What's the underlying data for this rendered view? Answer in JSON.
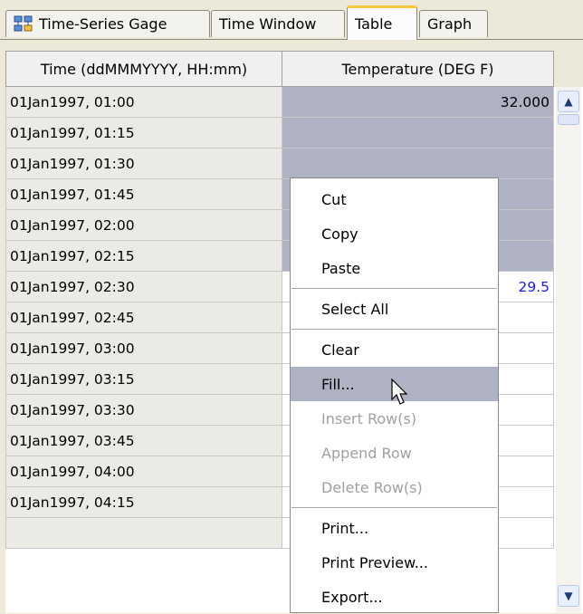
{
  "tabs": [
    {
      "label": "Time-Series Gage",
      "icon": "gage-icon"
    },
    {
      "label": "Time Window"
    },
    {
      "label": "Table",
      "active": true
    },
    {
      "label": "Graph"
    }
  ],
  "table": {
    "columns": [
      "Time (ddMMMYYYY, HH:mm)",
      "Temperature (DEG F)"
    ],
    "rows": [
      {
        "time": "01Jan1997, 01:00",
        "value": "32.000"
      },
      {
        "time": "01Jan1997, 01:15",
        "value": ""
      },
      {
        "time": "01Jan1997, 01:30",
        "value": ""
      },
      {
        "time": "01Jan1997, 01:45",
        "value": ""
      },
      {
        "time": "01Jan1997, 02:00",
        "value": ""
      },
      {
        "time": "01Jan1997, 02:15",
        "value": ""
      },
      {
        "time": "01Jan1997, 02:30",
        "value": "29.5"
      },
      {
        "time": "01Jan1997, 02:45",
        "value": ""
      },
      {
        "time": "01Jan1997, 03:00",
        "value": ""
      },
      {
        "time": "01Jan1997, 03:15",
        "value": ""
      },
      {
        "time": "01Jan1997, 03:30",
        "value": ""
      },
      {
        "time": "01Jan1997, 03:45",
        "value": ""
      },
      {
        "time": "01Jan1997, 04:00",
        "value": ""
      },
      {
        "time": "01Jan1997, 04:15",
        "value": ""
      },
      {
        "time": "",
        "value": ""
      }
    ]
  },
  "context_menu": {
    "groups": [
      [
        {
          "label": "Cut"
        },
        {
          "label": "Copy"
        },
        {
          "label": "Paste"
        }
      ],
      [
        {
          "label": "Select All"
        }
      ],
      [
        {
          "label": "Clear"
        },
        {
          "label": "Fill...",
          "highlighted": true
        },
        {
          "label": "Insert Row(s)",
          "disabled": true
        },
        {
          "label": "Append Row",
          "disabled": true
        },
        {
          "label": "Delete Row(s)",
          "disabled": true
        }
      ],
      [
        {
          "label": "Print..."
        },
        {
          "label": "Print Preview..."
        },
        {
          "label": "Export..."
        }
      ]
    ]
  },
  "colors": {
    "selection": "#aeb2c3",
    "active_tab_accent": "#ffc83c",
    "edited_value": "#1a1aff"
  }
}
